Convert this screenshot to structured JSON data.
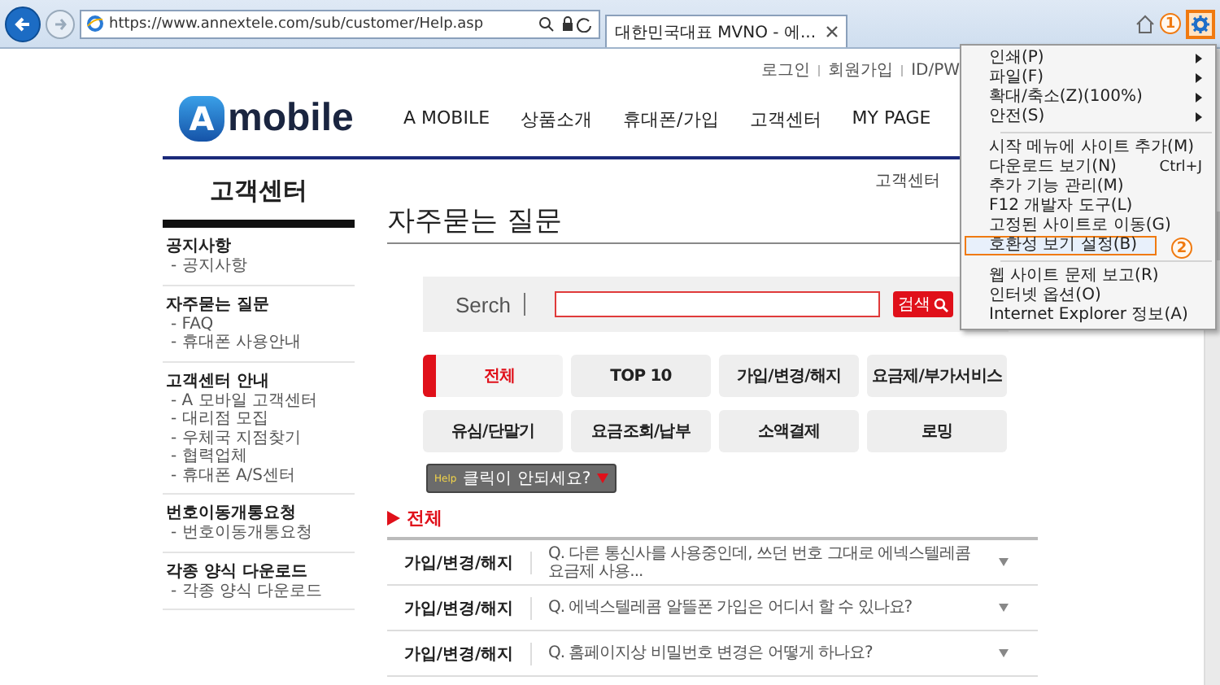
{
  "browser": {
    "url": "https://www.annextele.com/sub/customer/Help.asp",
    "tab_title": "대한민국대표 MVNO - 에...",
    "settings_highlighted": true,
    "callout": "1"
  },
  "top_links": [
    "로그인",
    "회원가입",
    "ID/PW"
  ],
  "logo": {
    "mark": "A",
    "text": "mobile"
  },
  "nav": [
    "A MOBILE",
    "상품소개",
    "휴대폰/가입",
    "고객센터",
    "MY PAGE"
  ],
  "sidebar": {
    "title": "고객센터",
    "sections": [
      {
        "title": "공지사항",
        "items": [
          "- 공지사항"
        ]
      },
      {
        "title": "자주묻는 질문",
        "items": [
          "- FAQ",
          "- 휴대폰 사용안내"
        ]
      },
      {
        "title": "고객센터 안내",
        "items": [
          "- A 모바일 고객센터",
          "- 대리점 모집",
          "- 우체국 지점찾기",
          "- 협력업체",
          "- 휴대폰 A/S센터"
        ]
      },
      {
        "title": "번호이동개통요청",
        "items": [
          "- 번호이동개통요청"
        ]
      },
      {
        "title": "각종 양식 다운로드",
        "items": [
          "- 각종 양식 다운로드"
        ]
      }
    ]
  },
  "breadcrumb": "고객센터",
  "heading": "자주묻는 질문",
  "search": {
    "label": "Serch",
    "button": "검색"
  },
  "categories": [
    {
      "label": "전체",
      "selected": true
    },
    {
      "label": "TOP 10",
      "selected": false
    },
    {
      "label": "가입/변경/해지",
      "selected": false
    },
    {
      "label": "요금제/부가서비스",
      "selected": false
    },
    {
      "label": "유심/단말기",
      "selected": false
    },
    {
      "label": "요금조회/납부",
      "selected": false
    },
    {
      "label": "소액결제",
      "selected": false
    },
    {
      "label": "로밍",
      "selected": false
    }
  ],
  "help_badge": {
    "tag": "Help",
    "text": "클릭이 안되세요?"
  },
  "faq": {
    "title": "전체",
    "rows": [
      {
        "category": "가입/변경/해지",
        "question": "Q. 다른 통신사를 사용중인데, 쓰던 번호 그대로 에넥스텔레콤 요금제 사용..."
      },
      {
        "category": "가입/변경/해지",
        "question": "Q. 에넥스텔레콤 알뜰폰 가입은 어디서 할 수 있나요?"
      },
      {
        "category": "가입/변경/해지",
        "question": "Q. 홈페이지상 비밀번호 변경은 어떻게 하나요?"
      }
    ]
  },
  "menu": {
    "callout": "2",
    "sections": [
      {
        "items": [
          {
            "label": "인쇄(P)",
            "submenu": true,
            "selected": false
          },
          {
            "label": "파일(F)",
            "submenu": true,
            "selected": false
          },
          {
            "label": "확대/축소(Z)(100%)",
            "submenu": true,
            "selected": false
          },
          {
            "label": "안전(S)",
            "submenu": true,
            "selected": false
          }
        ]
      },
      {
        "items": [
          {
            "label": "시작 메뉴에 사이트 추가(M)",
            "submenu": false,
            "selected": false
          },
          {
            "label": "다운로드 보기(N)",
            "shortcut": "Ctrl+J",
            "submenu": false,
            "selected": false
          },
          {
            "label": "추가 기능 관리(M)",
            "submenu": false,
            "selected": false
          },
          {
            "label": "F12 개발자 도구(L)",
            "submenu": false,
            "selected": false
          },
          {
            "label": "고정된 사이트로 이동(G)",
            "submenu": false,
            "selected": false
          },
          {
            "label": "호환성 보기 설정(B)",
            "submenu": false,
            "selected": true
          }
        ]
      },
      {
        "items": [
          {
            "label": "웹 사이트 문제 보고(R)",
            "submenu": false,
            "selected": false
          },
          {
            "label": "인터넷 옵션(O)",
            "submenu": false,
            "selected": false
          },
          {
            "label": "Internet Explorer 정보(A)",
            "submenu": false,
            "selected": false
          }
        ]
      }
    ]
  }
}
